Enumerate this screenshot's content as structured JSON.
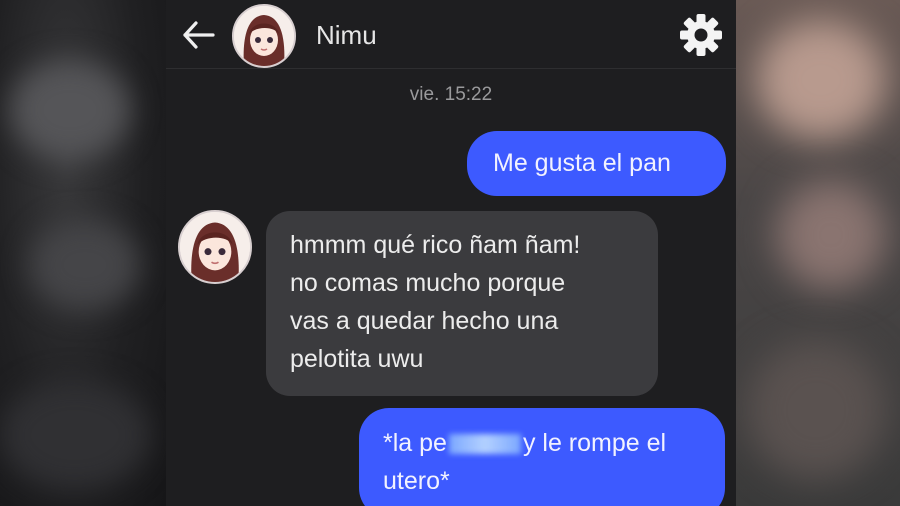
{
  "header": {
    "back_icon": "arrow-left-icon",
    "contact_name": "Nimu",
    "settings_icon": "gear-icon"
  },
  "conversation": {
    "timestamp": "vie. 15:22",
    "messages": [
      {
        "direction": "outgoing",
        "text": "Me gusta el pan"
      },
      {
        "direction": "incoming",
        "lines": [
          "hmmm qué rico ñam ñam!",
          "no comas mucho porque",
          "vas a quedar hecho una",
          "pelotita uwu"
        ]
      },
      {
        "direction": "outgoing",
        "line1_before": "*la pe",
        "line1_after": "y le rompe el",
        "line2": "utero*"
      }
    ]
  },
  "colors": {
    "outgoing_bubble": "#3d5aff",
    "incoming_bubble": "#3b3b3e",
    "background": "#1e1e20"
  }
}
